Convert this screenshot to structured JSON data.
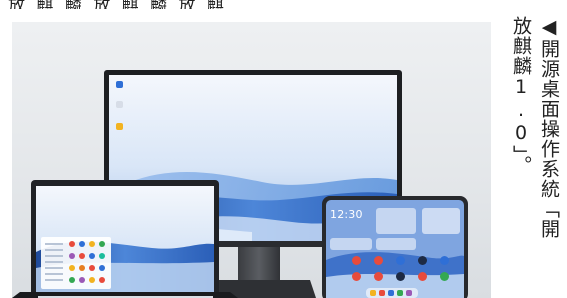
{
  "caption": {
    "column_1": "◀開源桌面操作系統「開",
    "column_2": "放麒麟1.0」。"
  },
  "tablet": {
    "clock": "12:30"
  },
  "colors": {
    "sky_light": "#e7f0fb",
    "wave_blue": "#3a6fc4",
    "wave_deep": "#1f4a9a",
    "device_frame": "#2a2c30"
  }
}
